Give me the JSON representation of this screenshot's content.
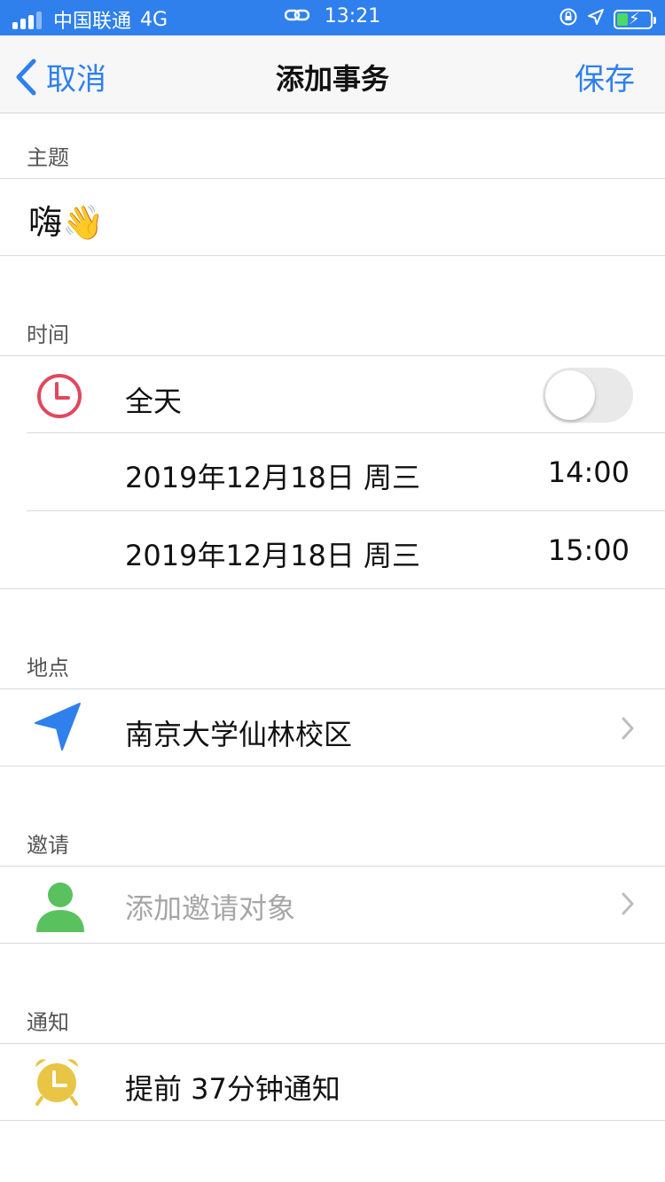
{
  "status_bar": {
    "carrier": "中国联通",
    "network": "4G",
    "time": "13:21"
  },
  "nav": {
    "back_label": "取消",
    "title": "添加事务",
    "save_label": "保存"
  },
  "subject": {
    "header": "主题",
    "value": "嗨👋"
  },
  "time": {
    "header": "时间",
    "all_day_label": "全天",
    "all_day_enabled": false,
    "start_date": "2019年12月18日 周三",
    "start_time": "14:00",
    "end_date": "2019年12月18日 周三",
    "end_time": "15:00"
  },
  "location": {
    "header": "地点",
    "value": "南京大学仙林校区"
  },
  "invite": {
    "header": "邀请",
    "placeholder": "添加邀请对象"
  },
  "notify": {
    "header": "通知",
    "value": "提前 37分钟通知"
  },
  "colors": {
    "accent": "#2f80ed",
    "clock_red": "#e0485e",
    "person_green": "#5ac15f",
    "alarm_yellow": "#e8c544"
  }
}
